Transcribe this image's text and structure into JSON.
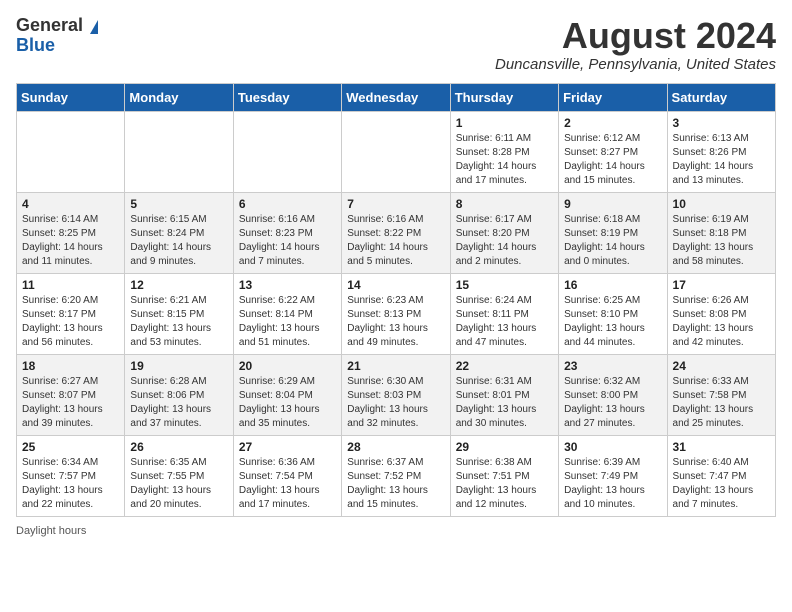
{
  "logo": {
    "general": "General",
    "blue": "Blue"
  },
  "title": "August 2024",
  "location": "Duncansville, Pennsylvania, United States",
  "days_of_week": [
    "Sunday",
    "Monday",
    "Tuesday",
    "Wednesday",
    "Thursday",
    "Friday",
    "Saturday"
  ],
  "footer": "Daylight hours",
  "weeks": [
    [
      {
        "day": "",
        "info": ""
      },
      {
        "day": "",
        "info": ""
      },
      {
        "day": "",
        "info": ""
      },
      {
        "day": "",
        "info": ""
      },
      {
        "day": "1",
        "info": "Sunrise: 6:11 AM\nSunset: 8:28 PM\nDaylight: 14 hours\nand 17 minutes."
      },
      {
        "day": "2",
        "info": "Sunrise: 6:12 AM\nSunset: 8:27 PM\nDaylight: 14 hours\nand 15 minutes."
      },
      {
        "day": "3",
        "info": "Sunrise: 6:13 AM\nSunset: 8:26 PM\nDaylight: 14 hours\nand 13 minutes."
      }
    ],
    [
      {
        "day": "4",
        "info": "Sunrise: 6:14 AM\nSunset: 8:25 PM\nDaylight: 14 hours\nand 11 minutes."
      },
      {
        "day": "5",
        "info": "Sunrise: 6:15 AM\nSunset: 8:24 PM\nDaylight: 14 hours\nand 9 minutes."
      },
      {
        "day": "6",
        "info": "Sunrise: 6:16 AM\nSunset: 8:23 PM\nDaylight: 14 hours\nand 7 minutes."
      },
      {
        "day": "7",
        "info": "Sunrise: 6:16 AM\nSunset: 8:22 PM\nDaylight: 14 hours\nand 5 minutes."
      },
      {
        "day": "8",
        "info": "Sunrise: 6:17 AM\nSunset: 8:20 PM\nDaylight: 14 hours\nand 2 minutes."
      },
      {
        "day": "9",
        "info": "Sunrise: 6:18 AM\nSunset: 8:19 PM\nDaylight: 14 hours\nand 0 minutes."
      },
      {
        "day": "10",
        "info": "Sunrise: 6:19 AM\nSunset: 8:18 PM\nDaylight: 13 hours\nand 58 minutes."
      }
    ],
    [
      {
        "day": "11",
        "info": "Sunrise: 6:20 AM\nSunset: 8:17 PM\nDaylight: 13 hours\nand 56 minutes."
      },
      {
        "day": "12",
        "info": "Sunrise: 6:21 AM\nSunset: 8:15 PM\nDaylight: 13 hours\nand 53 minutes."
      },
      {
        "day": "13",
        "info": "Sunrise: 6:22 AM\nSunset: 8:14 PM\nDaylight: 13 hours\nand 51 minutes."
      },
      {
        "day": "14",
        "info": "Sunrise: 6:23 AM\nSunset: 8:13 PM\nDaylight: 13 hours\nand 49 minutes."
      },
      {
        "day": "15",
        "info": "Sunrise: 6:24 AM\nSunset: 8:11 PM\nDaylight: 13 hours\nand 47 minutes."
      },
      {
        "day": "16",
        "info": "Sunrise: 6:25 AM\nSunset: 8:10 PM\nDaylight: 13 hours\nand 44 minutes."
      },
      {
        "day": "17",
        "info": "Sunrise: 6:26 AM\nSunset: 8:08 PM\nDaylight: 13 hours\nand 42 minutes."
      }
    ],
    [
      {
        "day": "18",
        "info": "Sunrise: 6:27 AM\nSunset: 8:07 PM\nDaylight: 13 hours\nand 39 minutes."
      },
      {
        "day": "19",
        "info": "Sunrise: 6:28 AM\nSunset: 8:06 PM\nDaylight: 13 hours\nand 37 minutes."
      },
      {
        "day": "20",
        "info": "Sunrise: 6:29 AM\nSunset: 8:04 PM\nDaylight: 13 hours\nand 35 minutes."
      },
      {
        "day": "21",
        "info": "Sunrise: 6:30 AM\nSunset: 8:03 PM\nDaylight: 13 hours\nand 32 minutes."
      },
      {
        "day": "22",
        "info": "Sunrise: 6:31 AM\nSunset: 8:01 PM\nDaylight: 13 hours\nand 30 minutes."
      },
      {
        "day": "23",
        "info": "Sunrise: 6:32 AM\nSunset: 8:00 PM\nDaylight: 13 hours\nand 27 minutes."
      },
      {
        "day": "24",
        "info": "Sunrise: 6:33 AM\nSunset: 7:58 PM\nDaylight: 13 hours\nand 25 minutes."
      }
    ],
    [
      {
        "day": "25",
        "info": "Sunrise: 6:34 AM\nSunset: 7:57 PM\nDaylight: 13 hours\nand 22 minutes."
      },
      {
        "day": "26",
        "info": "Sunrise: 6:35 AM\nSunset: 7:55 PM\nDaylight: 13 hours\nand 20 minutes."
      },
      {
        "day": "27",
        "info": "Sunrise: 6:36 AM\nSunset: 7:54 PM\nDaylight: 13 hours\nand 17 minutes."
      },
      {
        "day": "28",
        "info": "Sunrise: 6:37 AM\nSunset: 7:52 PM\nDaylight: 13 hours\nand 15 minutes."
      },
      {
        "day": "29",
        "info": "Sunrise: 6:38 AM\nSunset: 7:51 PM\nDaylight: 13 hours\nand 12 minutes."
      },
      {
        "day": "30",
        "info": "Sunrise: 6:39 AM\nSunset: 7:49 PM\nDaylight: 13 hours\nand 10 minutes."
      },
      {
        "day": "31",
        "info": "Sunrise: 6:40 AM\nSunset: 7:47 PM\nDaylight: 13 hours\nand 7 minutes."
      }
    ]
  ]
}
